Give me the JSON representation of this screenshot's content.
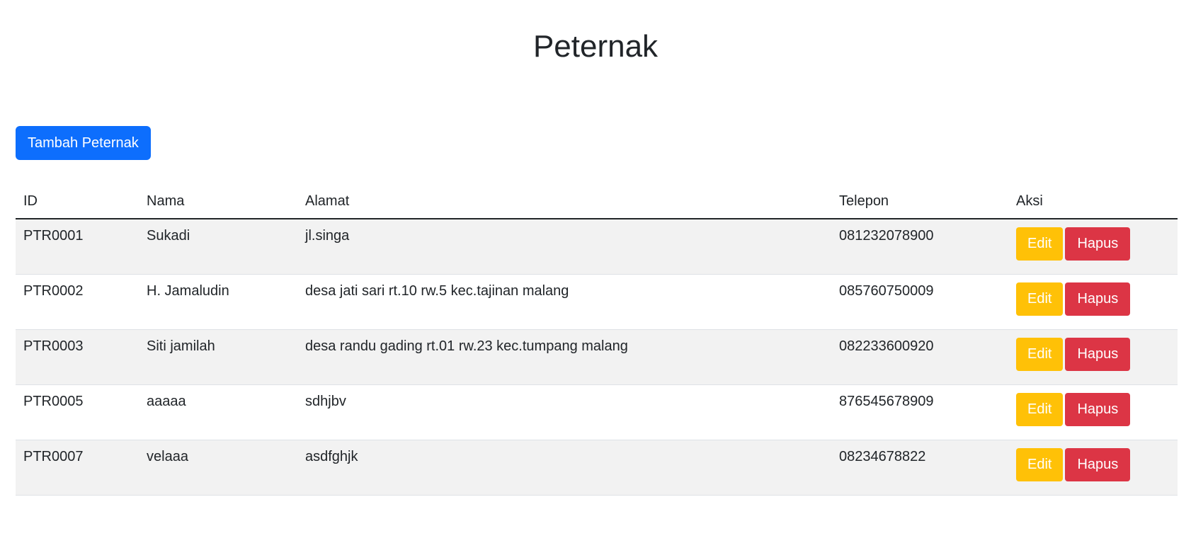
{
  "page": {
    "title": "Peternak",
    "add_button_label": "Tambah Peternak"
  },
  "table": {
    "headers": {
      "id": "ID",
      "nama": "Nama",
      "alamat": "Alamat",
      "telepon": "Telepon",
      "aksi": "Aksi"
    },
    "rows": [
      {
        "id": "PTR0001",
        "nama": "Sukadi",
        "alamat": "jl.singa",
        "telepon": "081232078900",
        "edit_label": "Edit",
        "delete_label": "Hapus"
      },
      {
        "id": "PTR0002",
        "nama": "H. Jamaludin",
        "alamat": "desa jati sari rt.10 rw.5 kec.tajinan malang",
        "telepon": "085760750009",
        "edit_label": "Edit",
        "delete_label": "Hapus"
      },
      {
        "id": "PTR0003",
        "nama": "Siti jamilah",
        "alamat": "desa randu gading rt.01 rw.23 kec.tumpang malang",
        "telepon": "082233600920",
        "edit_label": "Edit",
        "delete_label": "Hapus"
      },
      {
        "id": "PTR0005",
        "nama": "aaaaa",
        "alamat": "sdhjbv",
        "telepon": "876545678909",
        "edit_label": "Edit",
        "delete_label": "Hapus"
      },
      {
        "id": "PTR0007",
        "nama": "velaaa",
        "alamat": "asdfghjk",
        "telepon": "08234678822",
        "edit_label": "Edit",
        "delete_label": "Hapus"
      }
    ]
  },
  "colors": {
    "primary": "#0d6efd",
    "warning": "#ffc107",
    "danger": "#dc3545",
    "stripe": "#f2f2f2",
    "text": "#212529"
  }
}
